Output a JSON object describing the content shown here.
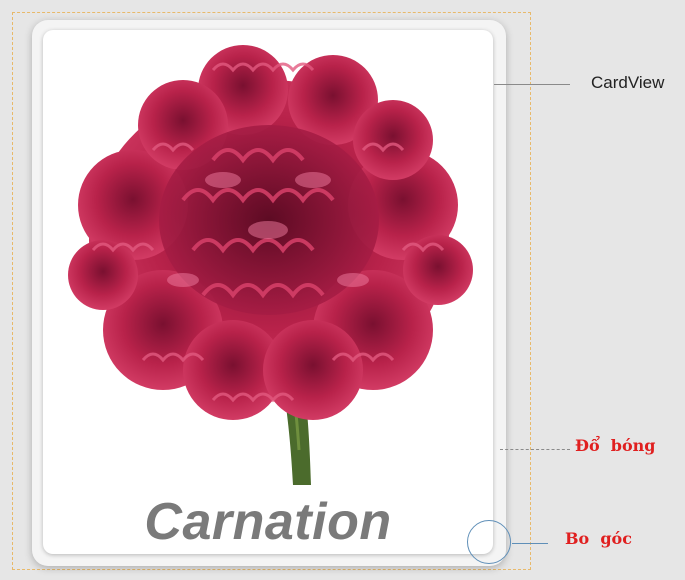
{
  "card": {
    "caption": "Carnation"
  },
  "annotations": {
    "cardview": "CardView",
    "shadow": "Đổ  bóng",
    "corner": "Bo  góc"
  },
  "colors": {
    "background": "#e6e6e6",
    "frame_dash": "#e8b96a",
    "annotation_red": "#e01f1f",
    "corner_marker": "#5f8fb8",
    "caption_gray": "#7a7a7a",
    "petal": "#c0294f"
  }
}
